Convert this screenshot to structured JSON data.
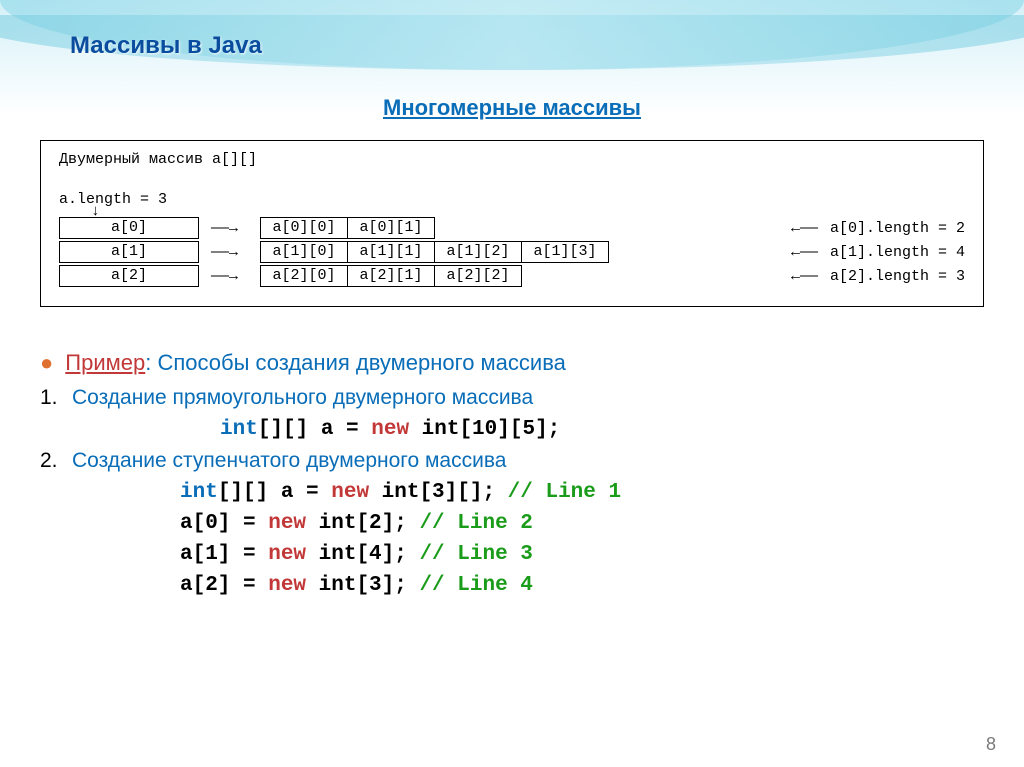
{
  "header": {
    "slide_title": "Массивы в Java",
    "section_title": "Многомерные массивы"
  },
  "diagram": {
    "title": "Двумерный массив a[][]",
    "length_line": "a.length = 3",
    "rows": [
      {
        "left": "a[0]",
        "cells": [
          "a[0][0]",
          "a[0][1]"
        ],
        "length": "a[0].length = 2"
      },
      {
        "left": "a[1]",
        "cells": [
          "a[1][0]",
          "a[1][1]",
          "a[1][2]",
          "a[1][3]"
        ],
        "length": "a[1].length = 4"
      },
      {
        "left": "a[2]",
        "cells": [
          "a[2][0]",
          "a[2][1]",
          "a[2][2]"
        ],
        "length": "a[2].length = 3"
      }
    ]
  },
  "example": {
    "primer_label": "Пример",
    "primer_desc": ": Способы создания двумерного массива",
    "item1": {
      "num": "1.",
      "text": "Создание прямоугольного двумерного массива",
      "code": {
        "int": "int",
        "mid": "[][] a = ",
        "new": "new",
        "rest": " int[10][5];"
      }
    },
    "item2": {
      "num": "2.",
      "text": "Создание ступенчатого двумерного массива",
      "lines": [
        {
          "int": "int",
          "mid": "[][] a = ",
          "new": "new",
          "rest": " int[3][]; ",
          "comment": "// Line 1"
        },
        {
          "int": "",
          "mid": "a[0] = ",
          "new": "new",
          "rest": " int[2]; ",
          "comment": "// Line 2"
        },
        {
          "int": "",
          "mid": "a[1] = ",
          "new": "new",
          "rest": " int[4]; ",
          "comment": "// Line 3"
        },
        {
          "int": "",
          "mid": "a[2] = ",
          "new": "new",
          "rest": " int[3]; ",
          "comment": "// Line 4"
        }
      ]
    }
  },
  "page_number": "8"
}
